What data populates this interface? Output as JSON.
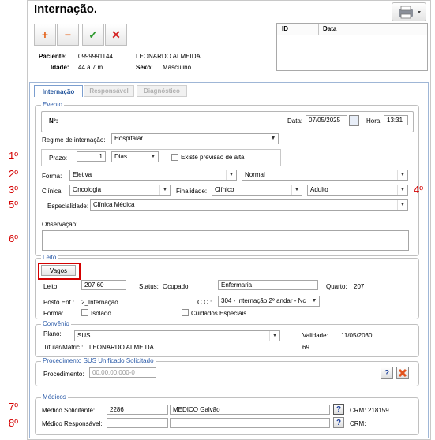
{
  "window": {
    "title": "Internação."
  },
  "toolbar": {
    "add": "+",
    "remove": "−",
    "confirm": "✓",
    "cancel": "✕"
  },
  "patient": {
    "paciente_label": "Paciente:",
    "paciente_id": "0999991144",
    "paciente_name": "LEONARDO ALMEIDA",
    "idade_label": "Idade:",
    "idade_value": "44 a 7 m",
    "sexo_label": "Sexo:",
    "sexo_value": "Masculino"
  },
  "top_grid": {
    "columns": [
      "ID",
      "Data"
    ]
  },
  "tabs": [
    {
      "label": "Internação",
      "active": true
    },
    {
      "label": "Responsável",
      "active": false
    },
    {
      "label": "Diagnóstico",
      "active": false
    }
  ],
  "evento": {
    "legend": "Evento",
    "no_label": "Nº:",
    "data_label": "Data:",
    "data_value": "07/05/2025",
    "hora_label": "Hora:",
    "hora_value": "13:31",
    "regime_label": "Regime de internação:",
    "regime_value": "Hospitalar",
    "prazo_label": "Prazo:",
    "prazo_value": "1",
    "prazo_unit": "Dias",
    "previsao_label": "Existe previsão de alta",
    "forma_label": "Forma:",
    "forma_value": "Eletiva",
    "forma2_value": "Normal",
    "clinica_label": "Clínica:",
    "clinica_value": "Oncologia",
    "finalidade_label": "Finalidade:",
    "finalidade_value": "Clínico",
    "faixa_value": "Adulto",
    "especialidade_label": "Especialidade:",
    "especialidade_value": "Clínica Médica",
    "observacao_label": "Observação:"
  },
  "leito": {
    "legend": "Leito",
    "vagos_button": "Vagos",
    "leito_label": "Leito:",
    "leito_value": "207.60",
    "status_label": "Status:",
    "status_value": "Ocupado",
    "tipo_value": "Enfermaria",
    "quarto_label": "Quarto:",
    "quarto_value": "207",
    "posto_label": "Posto Enf.:",
    "posto_value": "2_Internação",
    "cc_label": "C.C.:",
    "cc_value": "304 - Internação 2º andar - Nc",
    "forma_label": "Forma:",
    "isolado_label": "Isolado",
    "cuidados_label": "Cuidados Especiais"
  },
  "convenio": {
    "legend": "Convênio",
    "plano_label": "Plano:",
    "plano_value": "SUS",
    "validade_label": "Validade:",
    "validade_value": "11/05/2030",
    "titular_label": "Titular/Matric.:",
    "titular_value": "LEONARDO ALMEIDA",
    "matricula_value": "69"
  },
  "procedimento": {
    "legend": "Procedimento SUS Unificado Solicitado",
    "label": "Procedimento:",
    "placeholder": "00.00.00.000-0",
    "help": "?"
  },
  "medicos": {
    "legend": "Médicos",
    "solicitante_label": "Médico Solicitante:",
    "solicitante_code": "2286",
    "solicitante_name": "MEDICO  Galvão",
    "solicitante_crm_label": "CRM:",
    "solicitante_crm": "218159",
    "responsavel_label": "Médico Responsável:",
    "responsavel_crm_label": "CRM:",
    "help": "?"
  },
  "annotations": [
    "1º",
    "2º",
    "3º",
    "4º",
    "5º",
    "6º",
    "7º",
    "8º"
  ],
  "colors": {
    "accent": "#2a5aa8",
    "annotation": "#d40000",
    "highlight": "#d40000"
  }
}
